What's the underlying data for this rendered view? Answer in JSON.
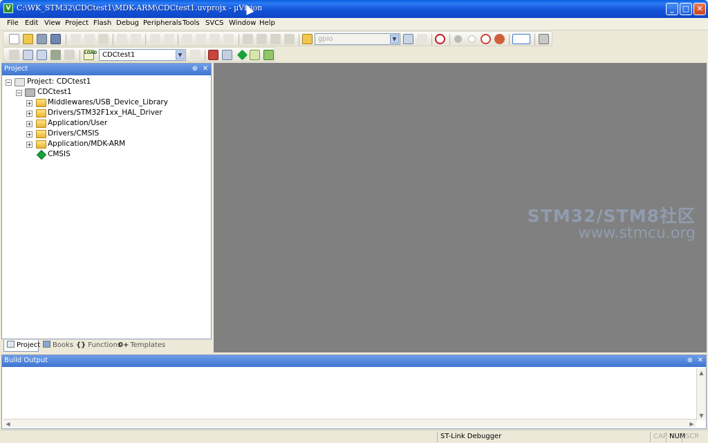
{
  "window": {
    "title": "C:\\WK_STM32\\CDCtest1\\MDK-ARM\\CDCtest1.uvprojx - µVision",
    "app_icon": "V",
    "minimize": "_",
    "maximize": "□",
    "close": "✕"
  },
  "menu": [
    "File",
    "Edit",
    "View",
    "Project",
    "Flash",
    "Debug",
    "Peripherals",
    "Tools",
    "SVCS",
    "Window",
    "Help"
  ],
  "toolbar": {
    "find_combo": "gpio",
    "target_combo": "CDCtest1",
    "load_label": "LOAD"
  },
  "project_panel": {
    "title": "Project",
    "pin": "⊕",
    "close": "✕",
    "root": "Project: CDCtest1",
    "target": "CDCtest1",
    "groups": [
      {
        "label": "Middlewares/USB_Device_Library"
      },
      {
        "label": "Drivers/STM32F1xx_HAL_Driver"
      },
      {
        "label": "Application/User"
      },
      {
        "label": "Drivers/CMSIS"
      },
      {
        "label": "Application/MDK-ARM"
      }
    ],
    "component": "CMSIS",
    "tabs": {
      "project": "Project",
      "books": "Books",
      "functions": "Functions",
      "functions_prefix": "{}",
      "templates": "Templates",
      "templates_prefix": "0+"
    }
  },
  "watermark": {
    "line1": "STM32/STM8社区",
    "line2": "www.stmcu.org"
  },
  "build_output": {
    "title": "Build Output",
    "pin": "⊕",
    "close": "✕"
  },
  "statusbar": {
    "debugger": "ST-Link Debugger",
    "cap": "CAP",
    "num": "NUM",
    "scrl": "SCRL"
  }
}
